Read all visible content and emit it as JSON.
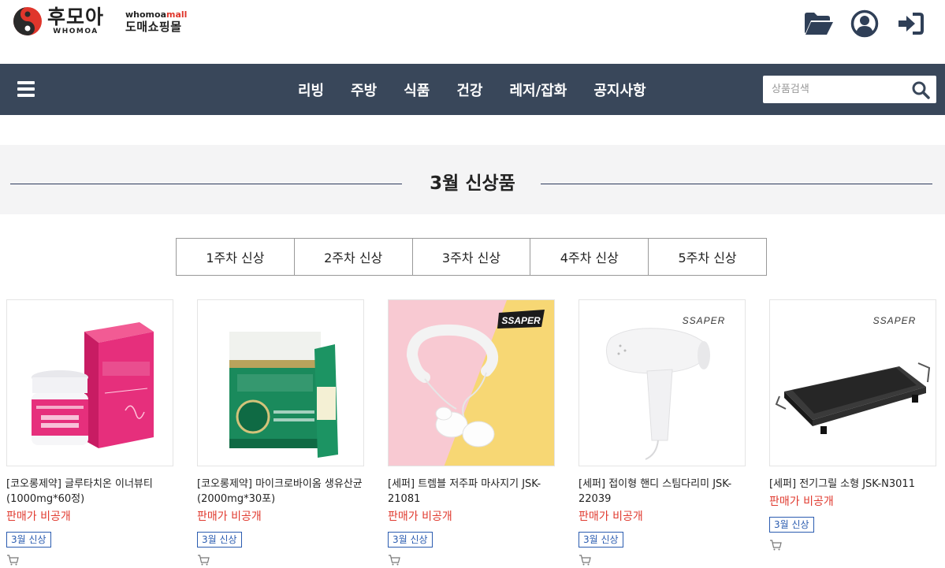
{
  "header": {
    "logo_kr": "후모아",
    "logo_en": "WHOMOA",
    "mall_en_prefix": "whomoa",
    "mall_en_suffix": "mall",
    "mall_kr": "도매쇼핑몰",
    "icons": [
      "folder-open-icon",
      "user-icon",
      "sign-in-icon"
    ]
  },
  "nav": {
    "items": [
      "리빙",
      "주방",
      "식품",
      "건강",
      "레저/잡화",
      "공지사항"
    ],
    "search_placeholder": "상품검색"
  },
  "section": {
    "title": "3월 신상품"
  },
  "tabs": [
    "1주차 신상",
    "2주차 신상",
    "3주차 신상",
    "4주차 신상",
    "5주차 신상"
  ],
  "products": [
    {
      "name": "[코오롱제약] 글루타치온 이너뷰티 (1000mg*60정)",
      "price": "판매가 비공개",
      "badge": "3월 신상",
      "image": "glutathione-box",
      "brand_text": ""
    },
    {
      "name": "[코오롱제약] 마이크로바이옴 생유산균 (2000mg*30포)",
      "price": "판매가 비공개",
      "badge": "3월 신상",
      "image": "probiotics-box",
      "brand_text": ""
    },
    {
      "name": "[세퍼] 트렘블 저주파 마사지기 JSK-21081",
      "price": "판매가 비공개",
      "badge": "3월 신상",
      "image": "neck-massager",
      "brand_text": "SSAPER"
    },
    {
      "name": "[세퍼] 접이형 핸디 스팀다리미 JSK-22039",
      "price": "판매가 비공개",
      "badge": "3월 신상",
      "image": "steam-iron",
      "brand_text": "SSAPER"
    },
    {
      "name": "[세퍼] 전기그릴 소형 JSK-N3011",
      "price": "판매가 비공개",
      "badge": "3월 신상",
      "image": "electric-grill",
      "brand_text": "SSAPER"
    }
  ],
  "colors": {
    "nav_bg": "#39475a",
    "price": "#e03a2f",
    "badge": "#2b5cb0"
  }
}
